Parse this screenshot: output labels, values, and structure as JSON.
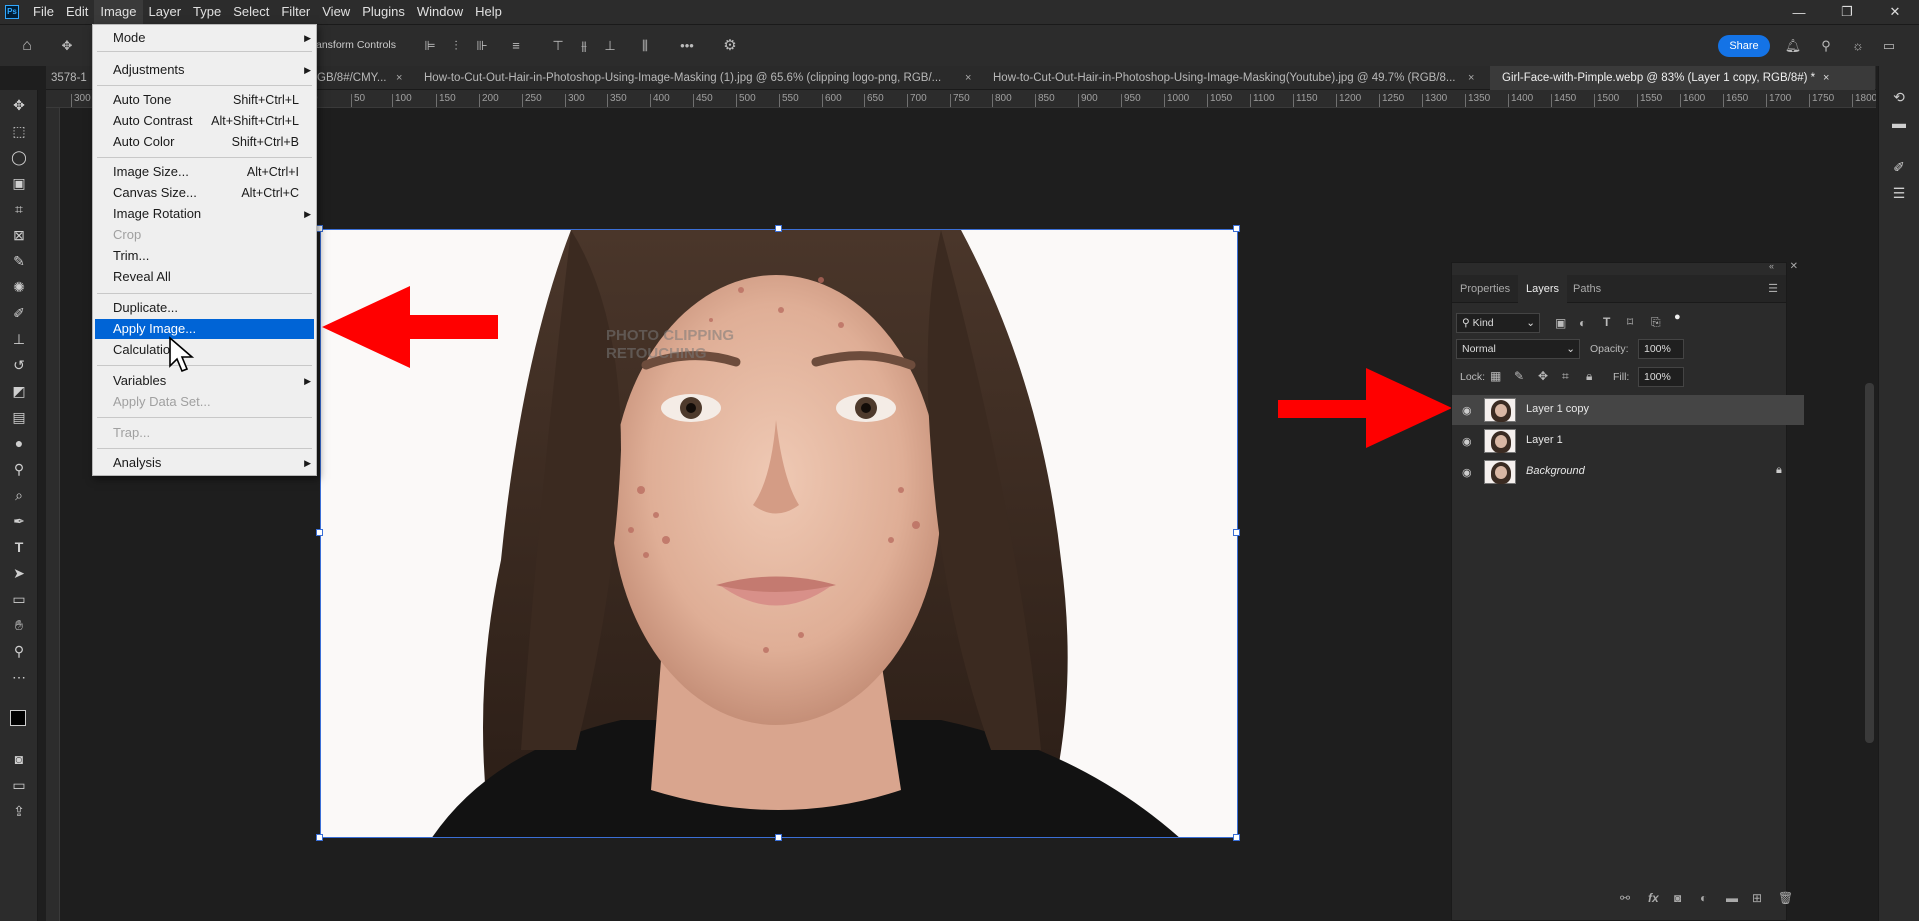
{
  "app": {
    "logo": "Ps"
  },
  "menubar": [
    "File",
    "Edit",
    "Image",
    "Layer",
    "Type",
    "Select",
    "Filter",
    "View",
    "Plugins",
    "Window",
    "Help"
  ],
  "window_controls": {
    "minimize": "—",
    "restore": "❐",
    "close": "✕"
  },
  "options_bar": {
    "transform_label": "ansform Controls",
    "share_label": "Share",
    "more_label": "•••"
  },
  "tabs": [
    {
      "label": "3578-1"
    },
    {
      "label": "GB/8#/CMY..."
    },
    {
      "label": "How-to-Cut-Out-Hair-in-Photoshop-Using-Image-Masking (1).jpg @ 65.6% (clipping logo-png, RGB/..."
    },
    {
      "label": "How-to-Cut-Out-Hair-in-Photoshop-Using-Image-Masking(Youtube).jpg @ 49.7% (RGB/8..."
    },
    {
      "label": "Girl-Face-with-Pimple.webp @ 83% (Layer 1 copy, RGB/8#) *"
    }
  ],
  "ruler_ticks": [
    "300",
    "",
    "0",
    "50",
    "100",
    "150",
    "200",
    "250",
    "300",
    "350",
    "400",
    "450",
    "500",
    "550",
    "600",
    "650",
    "700",
    "750",
    "800",
    "850",
    "900",
    "950",
    "1000",
    "1050",
    "1100",
    "1150",
    "1200",
    "1250",
    "1300",
    "1350",
    "1400",
    "1450",
    "1500",
    "1550",
    "1600",
    "1650",
    "1700",
    "1750",
    "1800",
    "18"
  ],
  "image_menu": {
    "items": [
      {
        "label": "Mode",
        "shortcut": "",
        "submenu": true,
        "disabled": false
      },
      {
        "label": "Adjustments",
        "shortcut": "",
        "submenu": true,
        "disabled": false
      },
      {
        "label": "Auto Tone",
        "shortcut": "Shift+Ctrl+L",
        "submenu": false,
        "disabled": false
      },
      {
        "label": "Auto Contrast",
        "shortcut": "Alt+Shift+Ctrl+L",
        "submenu": false,
        "disabled": false
      },
      {
        "label": "Auto Color",
        "shortcut": "Shift+Ctrl+B",
        "submenu": false,
        "disabled": false
      },
      {
        "label": "Image Size...",
        "shortcut": "Alt+Ctrl+I",
        "submenu": false,
        "disabled": false
      },
      {
        "label": "Canvas Size...",
        "shortcut": "Alt+Ctrl+C",
        "submenu": false,
        "disabled": false
      },
      {
        "label": "Image Rotation",
        "shortcut": "",
        "submenu": true,
        "disabled": false
      },
      {
        "label": "Crop",
        "shortcut": "",
        "submenu": false,
        "disabled": true
      },
      {
        "label": "Trim...",
        "shortcut": "",
        "submenu": false,
        "disabled": false
      },
      {
        "label": "Reveal All",
        "shortcut": "",
        "submenu": false,
        "disabled": false
      },
      {
        "label": "Duplicate...",
        "shortcut": "",
        "submenu": false,
        "disabled": false
      },
      {
        "label": "Apply Image...",
        "shortcut": "",
        "submenu": false,
        "disabled": false,
        "highlighted": true
      },
      {
        "label": "Calculatio",
        "shortcut": "",
        "submenu": false,
        "disabled": false
      },
      {
        "label": "Variables",
        "shortcut": "",
        "submenu": true,
        "disabled": false
      },
      {
        "label": "Apply Data Set...",
        "shortcut": "",
        "submenu": false,
        "disabled": true
      },
      {
        "label": "Trap...",
        "shortcut": "",
        "submenu": false,
        "disabled": true
      },
      {
        "label": "Analysis",
        "shortcut": "",
        "submenu": true,
        "disabled": false
      }
    ]
  },
  "canvas": {
    "watermark_line1": "PHOTO CLIPPING",
    "watermark_line2": "RETOUCHING"
  },
  "layers_panel": {
    "tabs": [
      "Properties",
      "Layers",
      "Paths"
    ],
    "active_tab": "Layers",
    "filter_kind": "Kind",
    "blend_mode": "Normal",
    "opacity_label": "Opacity:",
    "opacity_value": "100%",
    "lock_label": "Lock:",
    "fill_label": "Fill:",
    "fill_value": "100%",
    "layers": [
      {
        "name": "Layer 1 copy",
        "selected": true,
        "locked": false
      },
      {
        "name": "Layer 1",
        "selected": false,
        "locked": false
      },
      {
        "name": "Background",
        "selected": false,
        "locked": true
      }
    ],
    "bottom_icons": [
      "link-icon",
      "fx-icon",
      "mask-icon",
      "adjustment-icon",
      "folder-icon",
      "new-layer-icon",
      "trash-icon"
    ]
  },
  "colors": {
    "accent": "#0064d6",
    "share": "#1473e6",
    "arrow": "#ff0000"
  }
}
